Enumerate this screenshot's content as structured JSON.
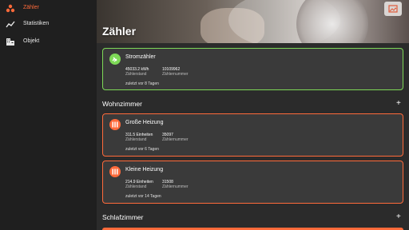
{
  "sidebar": {
    "items": [
      {
        "label": "Zähler",
        "icon": "meter-icon",
        "active": true
      },
      {
        "label": "Statistiken",
        "icon": "chart-line-icon",
        "active": false
      },
      {
        "label": "Objekt",
        "icon": "building-icon",
        "active": false
      }
    ]
  },
  "header": {
    "title": "Zähler",
    "edit_icon": "edit-image-icon"
  },
  "colors": {
    "accent": "#ff6a3a",
    "electric": "#7ed957",
    "background": "#2b2b2b",
    "sidebar": "#1f1f1f",
    "card": "#3a3a3a"
  },
  "meters": [
    {
      "name": "Stromzähler",
      "reading": "45033.2 kWh",
      "reading_label": "Zählerstand",
      "number": "10109962",
      "number_label": "Zählernummer",
      "last": "zuletzt vor 8 Tagen",
      "icon": "plug-icon"
    }
  ],
  "sections": [
    {
      "title": "Wohnzimmer",
      "add": "+",
      "meters": [
        {
          "name": "Große Heizung",
          "reading": "311.5 Einheiten",
          "reading_label": "Zählerstand",
          "number": "35097",
          "number_label": "Zählernummer",
          "last": "zuletzt vor 6 Tagen",
          "icon": "radiator-icon"
        },
        {
          "name": "Kleine Heizung",
          "reading": "214.9 Einheiten",
          "reading_label": "Zählerstand",
          "number": "31508",
          "number_label": "Zählernummer",
          "last": "zuletzt vor 14 Tagen",
          "icon": "radiator-icon"
        }
      ]
    },
    {
      "title": "Schlafzimmer",
      "add": "+",
      "meters": []
    }
  ]
}
